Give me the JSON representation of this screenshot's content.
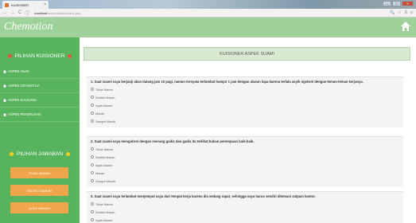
{
  "browser": {
    "tab_title": "KUISIONER",
    "tab_close": "×",
    "url_host": "localhost",
    "url_path": "/sistempakar/suami.php",
    "back": "←",
    "forward": "→",
    "reload": "C",
    "info": "ⓘ",
    "zoom": "🔍",
    "star": "☆",
    "ext": "X",
    "menu": "≡",
    "minimize": "—",
    "maximize": "□",
    "close": "X"
  },
  "header": {
    "brand": "Chemotion"
  },
  "sidebar": {
    "section_kuisioner": "PILIHAN KUISIONER",
    "items": [
      {
        "label": "ASPEK ANAK"
      },
      {
        "label": "ASPEK ORANGTUA"
      },
      {
        "label": "ASPEK SAUDARA"
      },
      {
        "label": "ASPEK PEKERJAAN"
      }
    ],
    "section_jawaban": "PILIHAN JAWABAN",
    "answers": [
      {
        "label": "TIDAK MARAH"
      },
      {
        "label": "SEDIKIT MARAH"
      },
      {
        "label": "AGAK MARAH"
      }
    ]
  },
  "main": {
    "title": "KUISIONER ASPEK SUAMI",
    "questions": [
      {
        "text": "1. Saat suami saya berjanji akan datang jam 10 pagi, namun ternyata terlambat hampir 1 jam dengan alasan lupa karena terlalu asyik ngobrol dengan teman-teman kerjanya.",
        "options": [
          "Tidak Marah",
          "Sedikit Marah",
          "Agak Marah",
          "Marah",
          "Sangat Marah"
        ]
      },
      {
        "text": "2. Saat suami saya mengobrol dengan seorang gadis dan gadis itu terlihat bukan perempuan baik-baik.",
        "options": [
          "Tidak Marah",
          "Sedikit Marah",
          "Agak Marah",
          "Marah",
          "Sangat Marah"
        ]
      },
      {
        "text": "3. Saat suami saya terlambat menjemput saya dari tempat kerja karena dia sedang rapat, sehingga saya harus sendiri ditemani satpam kantor.",
        "options": [
          "Tidak Marah",
          "Sedikit Marah",
          "Agak Marah"
        ]
      }
    ]
  },
  "colors": {
    "header": "#9fd29a",
    "sidebar": "#58b45c",
    "accent_orange": "#f0a64a",
    "title_bar": "#d8ebd2"
  }
}
